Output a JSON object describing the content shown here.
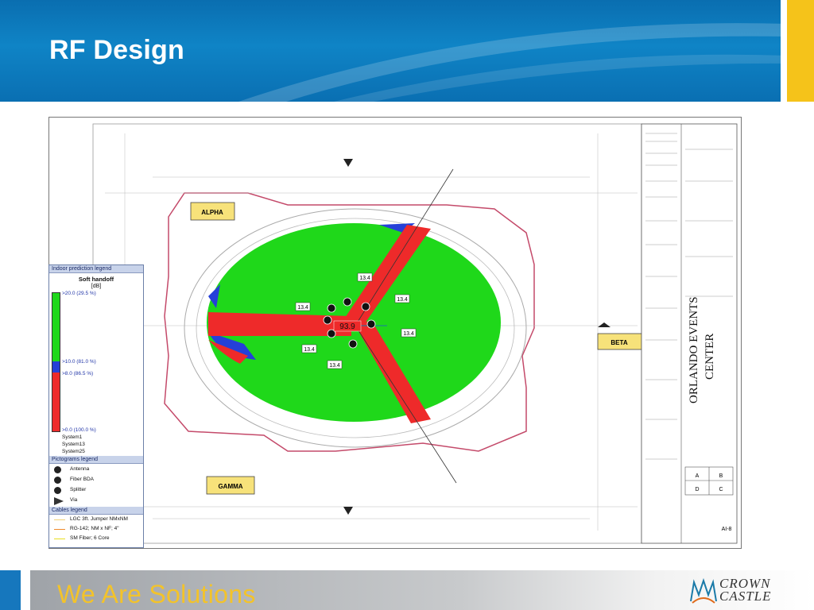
{
  "slide": {
    "title": "RF Design",
    "tagline": "We Are Solutions",
    "logo_line1": "CROWN",
    "logo_line2": "CASTLE"
  },
  "colors": {
    "header_blue": "#0f84c6",
    "accent_yellow": "#f5c31a",
    "coverage_strong": "#1fd81a",
    "coverage_mid": "#2540d8",
    "coverage_weak": "#ee2a2a",
    "zone_label_fill": "#f7e27a"
  },
  "drawing": {
    "zones": [
      "ALPHA",
      "BETA",
      "GAMMA"
    ],
    "center_value": "93.9",
    "antenna_values": [
      "13.4",
      "13.4",
      "13.4",
      "13.4",
      "13.4",
      "13.4"
    ],
    "title_block": {
      "venue_line1": "ORLANDO EVENTS",
      "venue_line2": "CENTER",
      "grid": [
        "A",
        "B",
        "D",
        "C"
      ],
      "sheet": "AI-8"
    }
  },
  "legend": {
    "header": "Indoor prediction legend",
    "subtitle": "Soft handoff",
    "unit": "[dB]",
    "levels": [
      ">20.0 (29.5 %)",
      ">10.0 (81.0 %)",
      ">8.0 (86.5 %)",
      ">0.0 (100.0 %)"
    ],
    "systems": [
      "System1",
      "System13",
      "System25"
    ],
    "pictograms_header": "Pictograms legend",
    "pictograms": [
      "Antenna",
      "Fiber BDA",
      "Splitter",
      "Via"
    ],
    "cables_header": "Cables legend",
    "cables": [
      "LGC 3ft. Jumper NMxNM",
      "RG-142; NM x NF; 4\"",
      "SM Fiber; 6 Core"
    ]
  }
}
